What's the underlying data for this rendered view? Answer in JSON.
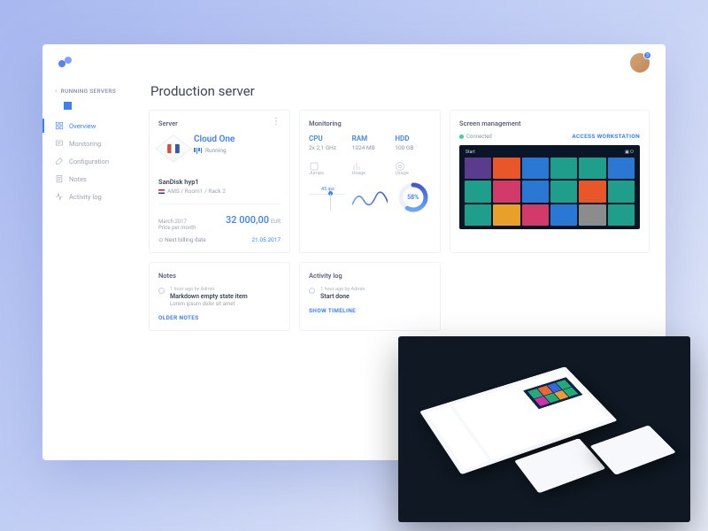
{
  "header": {
    "notifications": "3"
  },
  "sidebar": {
    "back_label": "RUNNING SERVERS",
    "items": [
      {
        "label": "Overview"
      },
      {
        "label": "Monitoring"
      },
      {
        "label": "Configuration"
      },
      {
        "label": "Notes"
      },
      {
        "label": "Activity log"
      }
    ]
  },
  "page": {
    "title": "Production server"
  },
  "server_card": {
    "title": "Server",
    "name": "Cloud One",
    "status": "Running",
    "host": "SanDisk hyp1",
    "location": "AMS / Room1 / Rack 2",
    "price_period": "March 2017",
    "price_label": "Price per month",
    "price_value": "32 000,00",
    "price_currency": "EUR",
    "next_billing_label": "Next billing date",
    "next_billing_value": "21.05.2017"
  },
  "monitoring_card": {
    "title": "Monitoring",
    "cpu": {
      "label": "CPU",
      "value": "2x 2,1 GHz",
      "metric": "Jumps",
      "jumps_reading": "45 ips"
    },
    "ram": {
      "label": "RAM",
      "value": "1024 MB",
      "metric": "Usage"
    },
    "hdd": {
      "label": "HDD",
      "value": "100 GB",
      "metric": "Usage",
      "percent": "58%"
    }
  },
  "screen_card": {
    "title": "Screen management",
    "connected": "Connected",
    "access": "ACCESS WORKSTATION",
    "start_label": "Start"
  },
  "notes_card": {
    "title": "Notes",
    "meta": "1 hour ago by Admin",
    "item_title": "Markdown empty state item",
    "item_body": "Lorem ipsum dolor sit amet",
    "link": "OLDER NOTES"
  },
  "activity_card": {
    "title": "Activity log",
    "meta": "1 hour ago by Admin",
    "item_title": "Start done",
    "link": "SHOW TIMELINE"
  },
  "chart_data": {
    "hdd_donut": {
      "type": "pie",
      "values": [
        58,
        42
      ],
      "title": "HDD Usage %"
    },
    "ram_wave": {
      "type": "line",
      "x": [
        0,
        1,
        2,
        3,
        4,
        5,
        6
      ],
      "values": [
        20,
        65,
        30,
        70,
        25,
        55,
        35
      ],
      "ylim": [
        0,
        100
      ]
    },
    "cpu_jumps": {
      "type": "line",
      "reading": 45,
      "unit": "ips"
    }
  },
  "tile_colors": [
    "#5a3b8c",
    "#e8562a",
    "#2a78d4",
    "#1f9e8c",
    "#1f9e8c",
    "#2a78d4",
    "#1f9e8c",
    "#d23a6a",
    "#2a78d4",
    "#1f9e8c",
    "#e8562a",
    "#1f9e8c",
    "#1f9e8c",
    "#e8a02a",
    "#d23a6a",
    "#2a78d4",
    "#8c8c8c",
    "#1f9e8c"
  ]
}
